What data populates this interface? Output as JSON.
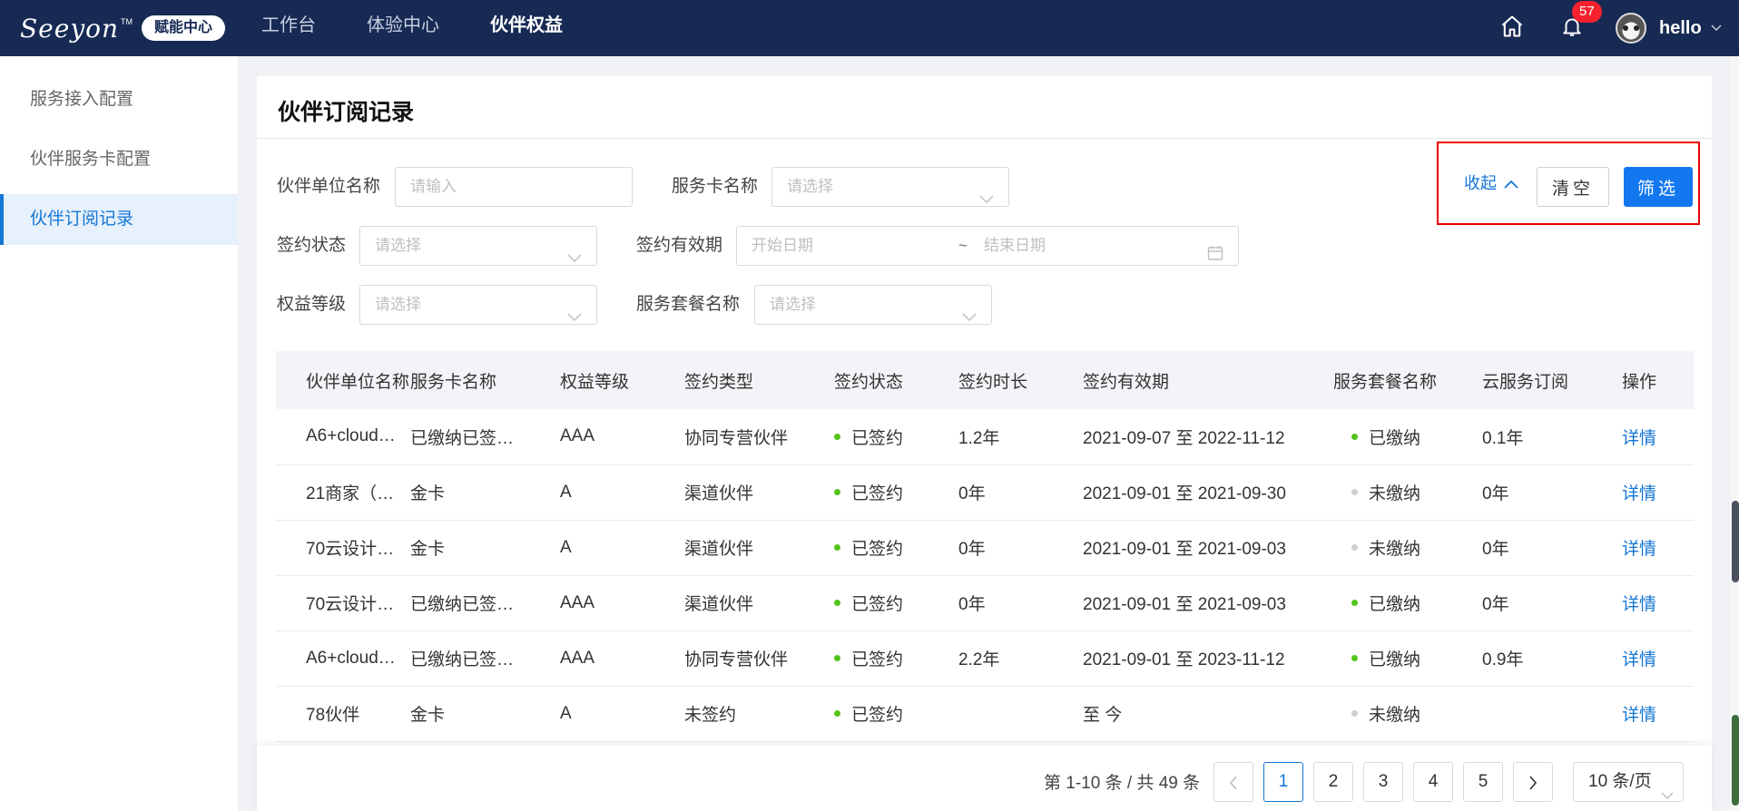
{
  "header": {
    "logo_text": "Seeyon",
    "logo_tm": "TM",
    "logo_badge": "赋能中心",
    "nav": [
      {
        "label": "工作台"
      },
      {
        "label": "体验中心"
      },
      {
        "label": "伙伴权益"
      }
    ],
    "notification_count": "57",
    "username": "hello"
  },
  "sidebar": {
    "items": [
      {
        "label": "服务接入配置"
      },
      {
        "label": "伙伴服务卡配置"
      },
      {
        "label": "伙伴订阅记录"
      }
    ]
  },
  "page": {
    "title": "伙伴订阅记录"
  },
  "filters": {
    "partner_unit_label": "伙伴单位名称",
    "partner_unit_placeholder": "请输入",
    "service_card_label": "服务卡名称",
    "service_card_placeholder": "请选择",
    "sign_status_label": "签约状态",
    "sign_status_placeholder": "请选择",
    "validity_label": "签约有效期",
    "start_date_placeholder": "开始日期",
    "range_separator": "~",
    "end_date_placeholder": "结束日期",
    "rights_level_label": "权益等级",
    "rights_level_placeholder": "请选择",
    "package_label": "服务套餐名称",
    "package_placeholder": "请选择",
    "collapse_label": "收起",
    "clear_label": "清空",
    "filter_label": "筛选"
  },
  "table": {
    "columns": [
      "伙伴单位名称",
      "服务卡名称",
      "权益等级",
      "签约类型",
      "签约状态",
      "签约时长",
      "签约有效期",
      "服务套餐名称",
      "云服务订阅",
      "操作"
    ],
    "rows": [
      {
        "unit": "A6+cloud…",
        "card": "已缴纳已签…",
        "level": "AAA",
        "type": "协同专营伙伴",
        "status": "已签约",
        "duration": "1.2年",
        "validity": "2021-09-07 至 2022-11-12",
        "package": "已缴纳",
        "package_state": "green",
        "cloud": "0.1年",
        "action": "详情"
      },
      {
        "unit": "21商家（…",
        "card": "金卡",
        "level": "A",
        "type": "渠道伙伴",
        "status": "已签约",
        "duration": "0年",
        "validity": "2021-09-01 至 2021-09-30",
        "package": "未缴纳",
        "package_state": "grey",
        "cloud": "0年",
        "action": "详情"
      },
      {
        "unit": "70云设计…",
        "card": "金卡",
        "level": "A",
        "type": "渠道伙伴",
        "status": "已签约",
        "duration": "0年",
        "validity": "2021-09-01 至 2021-09-03",
        "package": "未缴纳",
        "package_state": "grey",
        "cloud": "0年",
        "action": "详情"
      },
      {
        "unit": "70云设计…",
        "card": "已缴纳已签…",
        "level": "AAA",
        "type": "渠道伙伴",
        "status": "已签约",
        "duration": "0年",
        "validity": "2021-09-01 至 2021-09-03",
        "package": "已缴纳",
        "package_state": "green",
        "cloud": "0年",
        "action": "详情"
      },
      {
        "unit": "A6+cloud…",
        "card": "已缴纳已签…",
        "level": "AAA",
        "type": "协同专营伙伴",
        "status": "已签约",
        "duration": "2.2年",
        "validity": "2021-09-01 至 2023-11-12",
        "package": "已缴纳",
        "package_state": "green",
        "cloud": "0.9年",
        "action": "详情"
      },
      {
        "unit": "78伙伴",
        "card": "金卡",
        "level": "A",
        "type": "未签约",
        "status": "已签约",
        "duration": "",
        "validity": "至 今",
        "package": "未缴纳",
        "package_state": "grey",
        "cloud": "",
        "action": "详情"
      }
    ]
  },
  "pagination": {
    "summary": "第 1-10 条 / 共 49 条",
    "pages": [
      "1",
      "2",
      "3",
      "4",
      "5"
    ],
    "current_page": "1",
    "page_size": "10 条/页"
  },
  "colors": {
    "topbar": "#172a54",
    "primary": "#1476d6",
    "status_green": "#52c41a",
    "status_grey": "#d0d0d0",
    "highlight_box": "#e00000",
    "badge": "#f5222d"
  },
  "icons": {
    "home": "home-icon",
    "bell": "bell-icon",
    "calendar": "calendar-icon",
    "chevron_down": "chevron-down-icon",
    "chevron_up": "chevron-up-icon",
    "chevron_left": "chevron-left-icon",
    "chevron_right": "chevron-right-icon"
  }
}
